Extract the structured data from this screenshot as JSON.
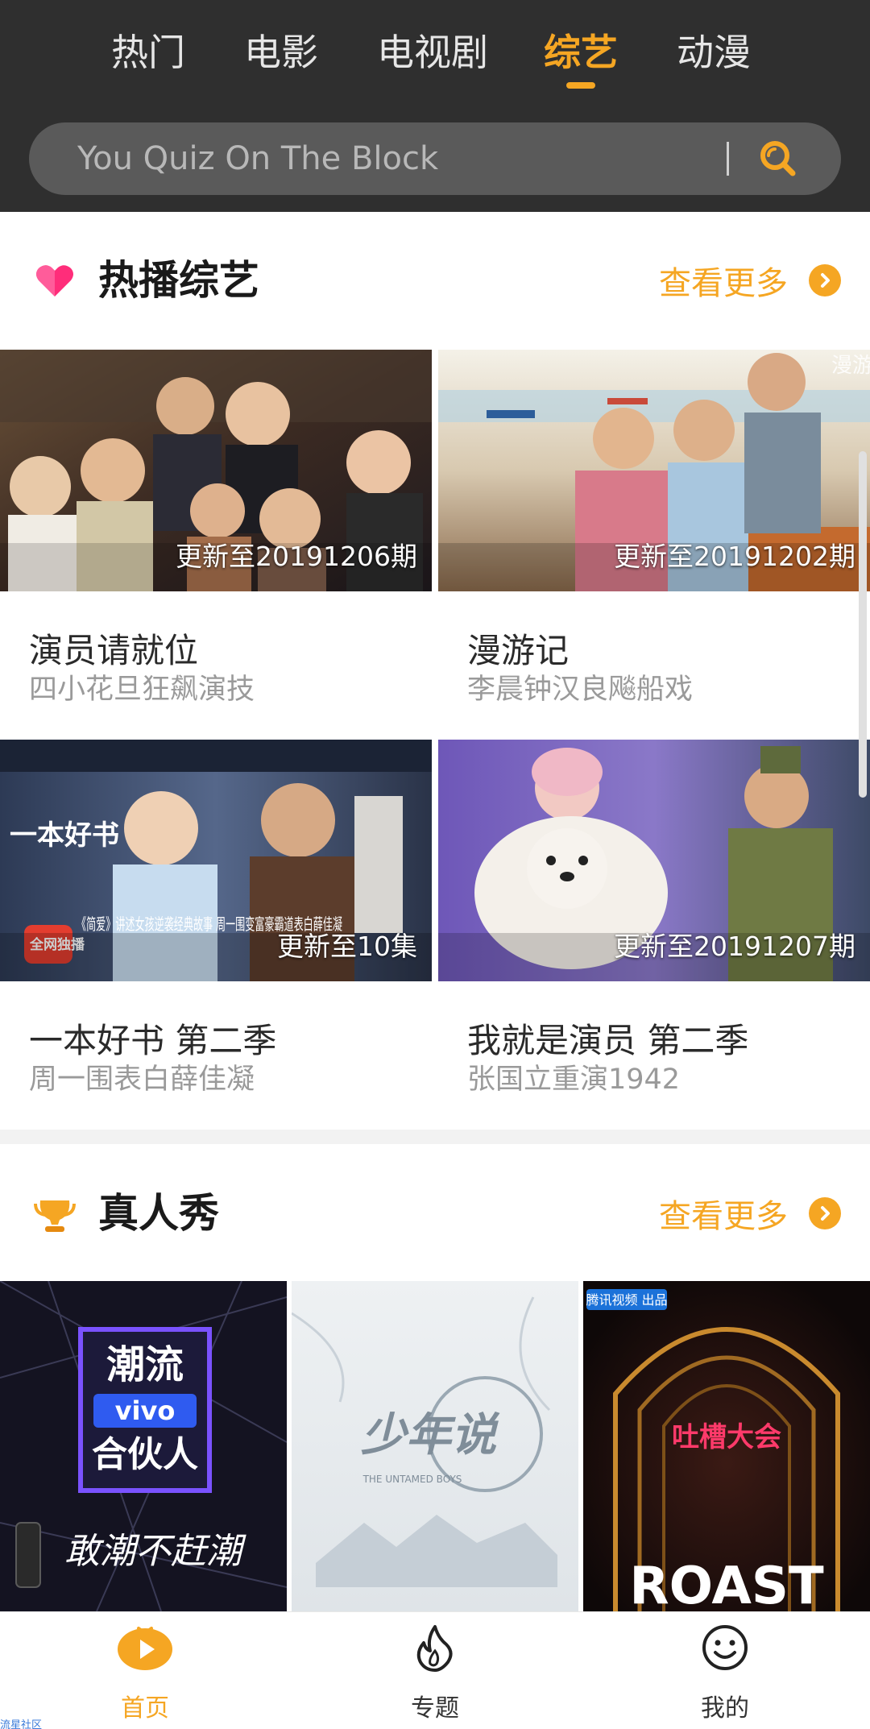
{
  "header": {
    "tabs": [
      {
        "label": "热门",
        "active": false
      },
      {
        "label": "电影",
        "active": false
      },
      {
        "label": "电视剧",
        "active": false
      },
      {
        "label": "综艺",
        "active": true
      },
      {
        "label": "动漫",
        "active": false
      }
    ],
    "search": {
      "placeholder": "You Quiz On The Block",
      "icon": "search-icon"
    }
  },
  "colors": {
    "accent": "#f5a623",
    "header_bg": "#2f2f2f",
    "heart": "#ff2d7a"
  },
  "hot_section": {
    "title": "热播综艺",
    "icon": "heart-icon",
    "more_label": "查看更多",
    "cards": [
      {
        "update": "更新至20191206期",
        "title": "演员请就位",
        "subtitle": "四小花旦狂飙演技"
      },
      {
        "update": "更新至20191202期",
        "title": "漫游记",
        "subtitle": "李晨钟汉良飚船戏",
        "corner_mark": "漫游记"
      },
      {
        "update": "更新至10集",
        "title": "一本好书 第二季",
        "subtitle": "周一围表白薛佳凝",
        "tags": [
          "一本好书",
          "全网独播"
        ],
        "caption": "《简爱》讲述女孩逆袭经典故事 周一围变富豪霸道表白薛佳凝"
      },
      {
        "update": "更新至20191207期",
        "title": "我就是演员 第二季",
        "subtitle": "张国立重演1942"
      }
    ]
  },
  "reality_section": {
    "title": "真人秀",
    "icon": "trophy-icon",
    "more_label": "查看更多",
    "posters": [
      {
        "line1": "潮流",
        "line2": "vivo",
        "line3": "合伙人",
        "slogan": "敢潮不赶潮"
      },
      {
        "logo": "少年说",
        "en": "THE UNTAMED BOYS"
      },
      {
        "badge": "腾讯视频 出品",
        "logo": "吐槽大会",
        "en": "ROAST"
      }
    ]
  },
  "bottom_nav": [
    {
      "label": "首页",
      "icon": "play-icon",
      "active": true
    },
    {
      "label": "专题",
      "icon": "flame-icon",
      "active": false
    },
    {
      "label": "我的",
      "icon": "smiley-icon",
      "active": false
    }
  ],
  "footer_corner": "流星社区"
}
